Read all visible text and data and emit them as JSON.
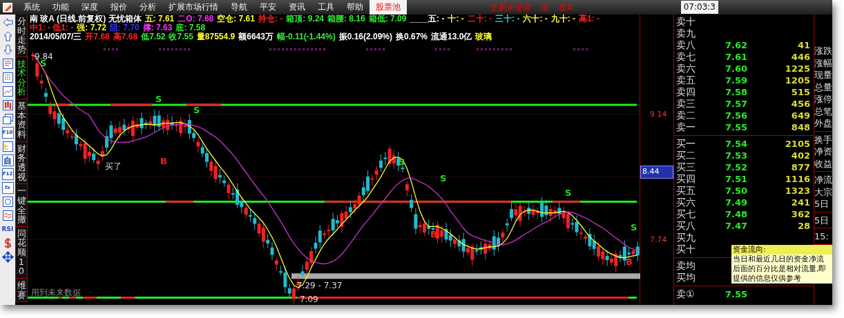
{
  "menu": {
    "items": [
      {
        "label": "系统",
        "selected": false
      },
      {
        "label": "功能",
        "selected": false
      },
      {
        "label": "深度",
        "selected": false
      },
      {
        "label": "报价",
        "selected": false
      },
      {
        "label": "分析",
        "selected": false
      },
      {
        "label": "扩展市场行情",
        "selected": false
      },
      {
        "label": "导航",
        "selected": false
      },
      {
        "label": "平安",
        "selected": false
      },
      {
        "label": "资讯",
        "selected": false
      },
      {
        "label": "工具",
        "selected": false
      },
      {
        "label": "帮助",
        "selected": false
      },
      {
        "label": "股票池",
        "selected": true
      }
    ],
    "status": [
      "交易未登录",
      "南",
      "玻A"
    ],
    "time": "07:03:3"
  },
  "toolbar": [
    {
      "kind": "arrow-left"
    },
    {
      "kind": "arrow-up"
    },
    {
      "kind": "arrow-down"
    },
    {
      "kind": "report"
    },
    {
      "kind": "grid"
    },
    {
      "kind": "line"
    },
    {
      "kind": "candles"
    },
    {
      "kind": "pages"
    },
    {
      "kind": "text",
      "label": "F10"
    },
    {
      "kind": "tree"
    },
    {
      "kind": "text",
      "label": "自"
    },
    {
      "kind": "text",
      "label": "F12"
    },
    {
      "kind": "text",
      "label": "fx"
    },
    {
      "kind": "circle"
    },
    {
      "kind": "wave"
    },
    {
      "kind": "plain",
      "label": "RSI"
    },
    {
      "kind": "dollar"
    },
    {
      "kind": "move"
    }
  ],
  "tabs": [
    {
      "label": "分时走势",
      "selected": false
    },
    {
      "label": "技术分析",
      "selected": true
    },
    {
      "label": "基本资料",
      "selected": false
    },
    {
      "label": "财务透视",
      "selected": false
    },
    {
      "label": "一键全撤",
      "selected": false
    },
    {
      "label": "同花顺10",
      "selected": false
    },
    {
      "label": "维赛",
      "selected": false
    }
  ],
  "header": [
    [
      {
        "text": "南 玻A (日线.前复权) 无忧箱体",
        "color": "#ffffff"
      },
      {
        "text": "五: 7.61",
        "color": "#ffff33"
      },
      {
        "text": "二O: 7.68",
        "color": "#ff33ff"
      },
      {
        "text": "空仓: 7.61",
        "color": "#ffff33"
      },
      {
        "text": "持仓: -",
        "color": "#ff2020"
      },
      {
        "text": "箱顶: 9.24",
        "color": "#33ee33"
      },
      {
        "text": "箱腰: 8.16",
        "color": "#33ee33"
      },
      {
        "text": "箱低: 7.09",
        "color": "#33ee33"
      },
      {
        "text": "____五: -",
        "color": "#ffffff"
      },
      {
        "text": "十: -",
        "color": "#ffff33"
      },
      {
        "text": "二十: -",
        "color": "#ff2020"
      },
      {
        "text": "三十: -",
        "color": "#33dddd"
      },
      {
        "text": "六十: -",
        "color": "#ffff33"
      },
      {
        "text": "九十: -",
        "color": "#ffff33"
      },
      {
        "text": "高1: -",
        "color": "#ff2020"
      }
    ],
    [
      {
        "text": "中1: - 低1: -",
        "color": "#ff2020"
      },
      {
        "text": "强: 7.72",
        "color": "#ffff33"
      },
      {
        "text": "阻: 7.70",
        "color": "#3333ff"
      },
      {
        "text": "撑: 7.63",
        "color": "#ff33ff"
      },
      {
        "text": "底: 7.58",
        "color": "#33ee33"
      }
    ],
    [
      {
        "text": "2014/05/07/三",
        "color": "#ffffff"
      },
      {
        "text": "开7.68",
        "color": "#ff2020"
      },
      {
        "text": "高7.68",
        "color": "#ff2020"
      },
      {
        "text": "低7.52",
        "color": "#33ee33"
      },
      {
        "text": "收7.55",
        "color": "#33ee33"
      },
      {
        "text": "量87554.9",
        "color": "#ffff33"
      },
      {
        "text": "额6643万",
        "color": "#ffffff"
      },
      {
        "text": "幅-0.11(-1.44%)",
        "color": "#33ee33"
      },
      {
        "text": "振0.16(2.09%)",
        "color": "#ffffff"
      },
      {
        "text": "换0.67%",
        "color": "#ffffff"
      },
      {
        "text": "流通13.0亿",
        "color": "#ffffff"
      },
      {
        "text": "玻璃",
        "color": "#ffff33"
      }
    ]
  ],
  "chart": {
    "labels": [
      {
        "text": "9.84",
        "kind": "price"
      },
      {
        "text": "S",
        "kind": "sell"
      },
      {
        "text": "S",
        "kind": "sell"
      },
      {
        "text": "S",
        "kind": "sell"
      },
      {
        "text": "S",
        "kind": "sell"
      },
      {
        "text": "S",
        "kind": "sell"
      },
      {
        "text": "S",
        "kind": "sell"
      },
      {
        "text": "S",
        "kind": "sell"
      },
      {
        "text": "B",
        "kind": "buy"
      },
      {
        "text": "B",
        "kind": "buy"
      },
      {
        "text": "B",
        "kind": "buy"
      },
      {
        "text": "买了",
        "kind": "note"
      },
      {
        "text": "7.29 - 7.37",
        "kind": "price"
      },
      {
        "text": "7.09",
        "kind": "price"
      },
      {
        "text": "用到未来数据",
        "kind": "hint"
      }
    ]
  },
  "axis": {
    "labels": [
      "9.14",
      "7.74"
    ],
    "cursor_label": "8.44"
  },
  "book": {
    "sell": [
      {
        "label": "卖十"
      },
      {
        "label": "卖九"
      },
      {
        "label": "卖八",
        "price": "7.62",
        "volume": "41"
      },
      {
        "label": "卖七",
        "price": "7.61",
        "volume": "446"
      },
      {
        "label": "卖六",
        "price": "7.60",
        "volume": "1225"
      },
      {
        "label": "卖五",
        "price": "7.59",
        "volume": "1205"
      },
      {
        "label": "卖四",
        "price": "7.58",
        "volume": "515"
      },
      {
        "label": "卖三",
        "price": "7.57",
        "volume": "456"
      },
      {
        "label": "卖二",
        "price": "7.56",
        "volume": "649"
      },
      {
        "label": "卖一",
        "price": "7.55",
        "volume": "848"
      }
    ],
    "buy": [
      {
        "label": "买一",
        "price": "7.54",
        "volume": "2105"
      },
      {
        "label": "买二",
        "price": "7.53",
        "volume": "402"
      },
      {
        "label": "买三",
        "price": "7.52",
        "volume": "877"
      },
      {
        "label": "买四",
        "price": "7.51",
        "volume": "1116"
      },
      {
        "label": "买五",
        "price": "7.50",
        "volume": "1323"
      },
      {
        "label": "买六",
        "price": "7.49",
        "volume": "241"
      },
      {
        "label": "买七",
        "price": "7.48",
        "volume": "362"
      },
      {
        "label": "买八",
        "price": "7.47",
        "volume": "28"
      },
      {
        "label": "买九"
      },
      {
        "label": "买十"
      }
    ],
    "averages": [
      {
        "label": "卖均"
      },
      {
        "label": "买均"
      }
    ],
    "extra": [
      {
        "label": "卖①",
        "price": "7.55"
      }
    ]
  },
  "stats": [
    [
      "涨跌",
      "涨幅",
      "现量",
      "总量",
      "涨停",
      "总笔",
      "外盘"
    ],
    [
      "换手",
      "净资",
      "收益"
    ],
    [
      "净流",
      "大宗",
      "5日"
    ],
    [
      "5日"
    ],
    [
      "15:"
    ]
  ],
  "tooltip": {
    "title": "资金流向:",
    "lines": [
      "当日和最近几日的资金净流",
      "后面的百分比是相对流量,即",
      "提供的信息仅供参考"
    ]
  }
}
